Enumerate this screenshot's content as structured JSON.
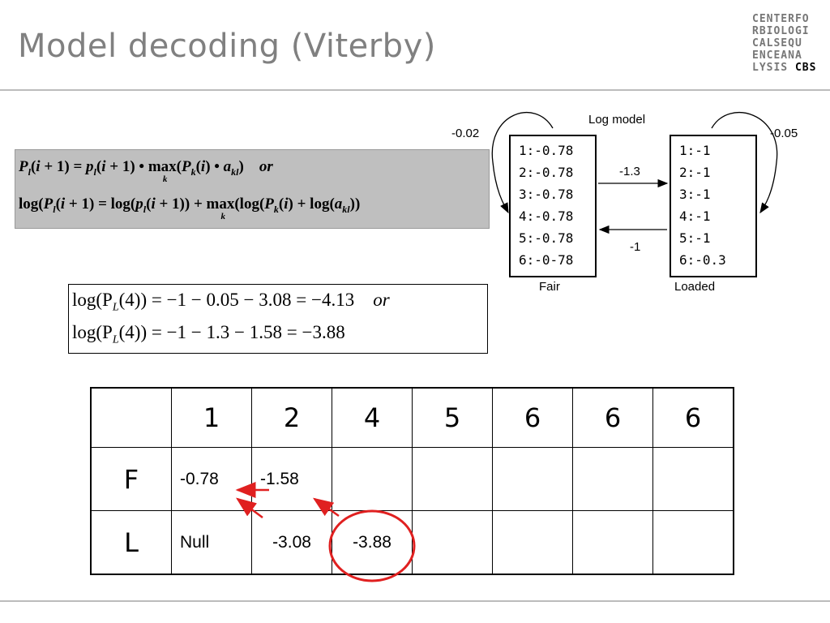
{
  "slide": {
    "title": "Model decoding (Viterby)",
    "logo_lines": [
      "CENTERFO",
      "RBIOLOGI",
      "CALSEQU",
      "ENCEANA",
      "LYSIS"
    ],
    "logo_cbs": "CBS"
  },
  "formulas": {
    "recursion_mult_prefix": "P",
    "recursion_line1": "P_l(i+1) = p_l(i+1) • max_k(P_k(i) • a_kl)   or",
    "recursion_line2": "log(P_l(i+1)) = log(p_l(i+1)) + max_k(log(P_k(i)) + log(a_kl))",
    "or_word": "or",
    "example_line1_lhs": "log(P",
    "example_sub": "L",
    "example_line1_rhs": "(4)) = −1 − 0.05 − 3.08 = −4.13",
    "example_line2_rhs": "(4)) = −1 − 1.3 − 1.58 = −3.88"
  },
  "model": {
    "title": "Log model",
    "fair": {
      "label": "Fair",
      "self_transition": "-0.02",
      "emissions": [
        "1:-0.78",
        "2:-0.78",
        "3:-0.78",
        "4:-0.78",
        "5:-0.78",
        "6:-0-78"
      ]
    },
    "loaded": {
      "label": "Loaded",
      "self_transition": "-0.05",
      "emissions": [
        "1:-1",
        "2:-1",
        "3:-1",
        "4:-1",
        "5:-1",
        "6:-0.3"
      ]
    },
    "fair_to_loaded": "-1.3",
    "loaded_to_fair": "-1"
  },
  "table": {
    "columns": [
      "",
      "1",
      "2",
      "4",
      "5",
      "6",
      "6",
      "6"
    ],
    "rows": [
      {
        "label": "F",
        "cells": [
          "-0.78",
          "-1.58",
          "",
          "",
          "",
          "",
          ""
        ]
      },
      {
        "label": "L",
        "cells": [
          "Null",
          "-3.08",
          "-3.88",
          "",
          "",
          "",
          ""
        ]
      }
    ]
  },
  "colors": {
    "title_gray": "#808080",
    "formula_bg": "#bfbfbf",
    "annotation_red": "#e02020"
  }
}
